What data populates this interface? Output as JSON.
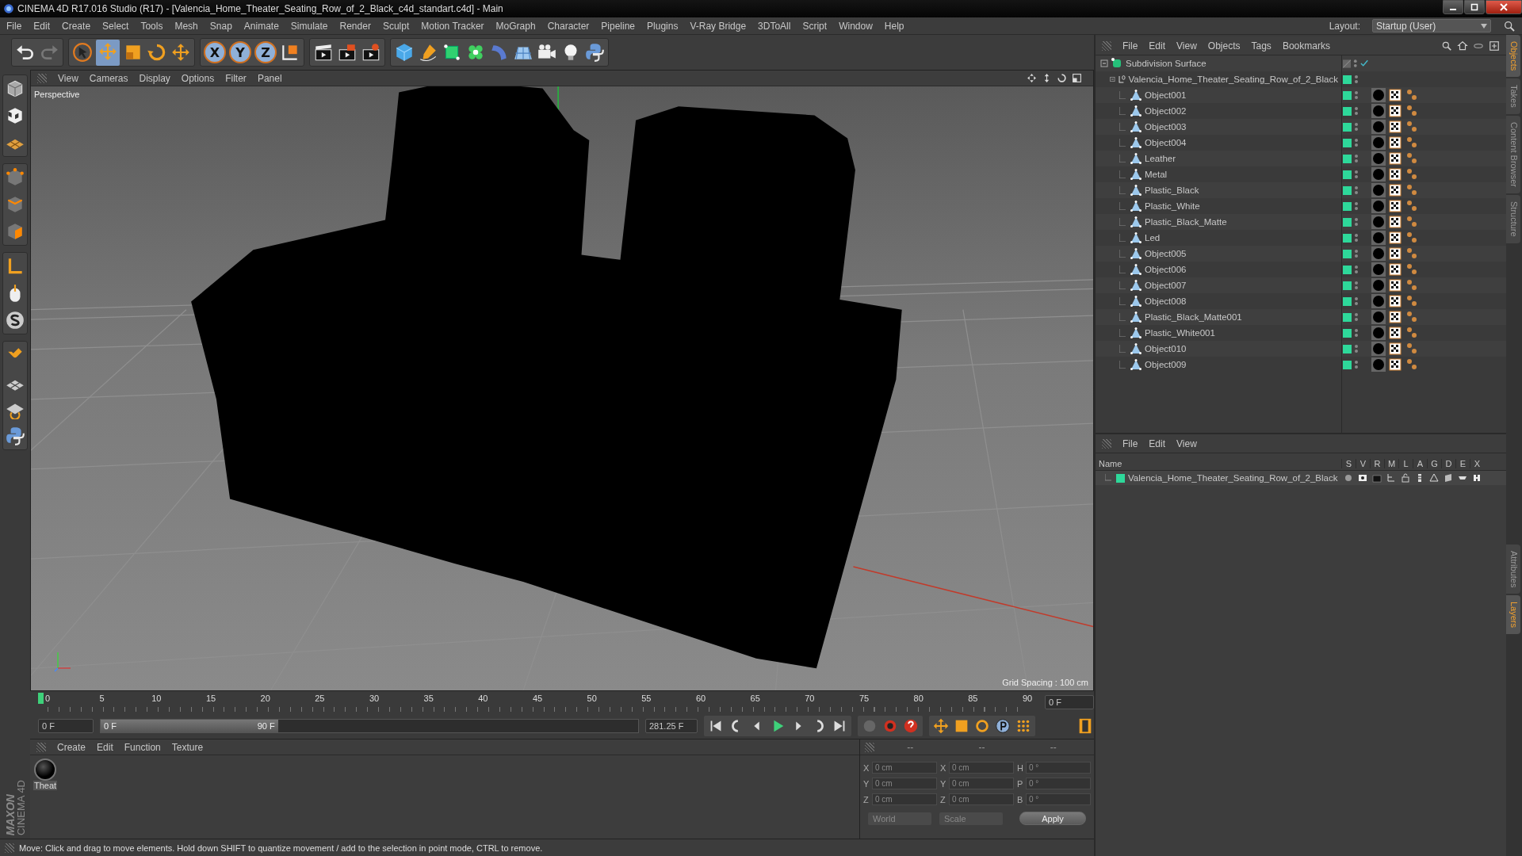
{
  "window": {
    "title": "CINEMA 4D R17.016 Studio (R17) - [Valencia_Home_Theater_Seating_Row_of_2_Black_c4d_standart.c4d] - Main"
  },
  "menu_bar": [
    "File",
    "Edit",
    "Create",
    "Select",
    "Tools",
    "Mesh",
    "Snap",
    "Animate",
    "Simulate",
    "Render",
    "Sculpt",
    "Motion Tracker",
    "MoGraph",
    "Character",
    "Pipeline",
    "Plugins",
    "V-Ray Bridge",
    "3DToAll",
    "Script",
    "Window",
    "Help"
  ],
  "layout": {
    "label": "Layout:",
    "value": "Startup (User)"
  },
  "axis_buttons": [
    {
      "label": "X",
      "selected": true
    },
    {
      "label": "Y",
      "selected": true
    },
    {
      "label": "Z",
      "selected": true
    }
  ],
  "viewport": {
    "menu": [
      "View",
      "Cameras",
      "Display",
      "Options",
      "Filter",
      "Panel"
    ],
    "camera": "Perspective",
    "grid_spacing": "Grid Spacing : 100 cm"
  },
  "object_manager": {
    "menu": [
      "File",
      "Edit",
      "View",
      "Objects",
      "Tags",
      "Bookmarks"
    ],
    "tree": [
      {
        "name": "Subdivision Surface",
        "kind": "generator",
        "expanded": true,
        "children": [
          {
            "name": "Valencia_Home_Theater_Seating_Row_of_2_Black",
            "kind": "null",
            "expanded": true,
            "children": [
              {
                "name": "Object001",
                "kind": "polygon"
              },
              {
                "name": "Object002",
                "kind": "polygon"
              },
              {
                "name": "Object003",
                "kind": "polygon"
              },
              {
                "name": "Object004",
                "kind": "polygon"
              },
              {
                "name": "Leather",
                "kind": "polygon"
              },
              {
                "name": "Metal",
                "kind": "polygon"
              },
              {
                "name": "Plastic_Black",
                "kind": "polygon"
              },
              {
                "name": "Plastic_White",
                "kind": "polygon"
              },
              {
                "name": "Plastic_Black_Matte",
                "kind": "polygon"
              },
              {
                "name": "Led",
                "kind": "polygon"
              },
              {
                "name": "Object005",
                "kind": "polygon"
              },
              {
                "name": "Object006",
                "kind": "polygon"
              },
              {
                "name": "Object007",
                "kind": "polygon"
              },
              {
                "name": "Object008",
                "kind": "polygon"
              },
              {
                "name": "Plastic_Black_Matte001",
                "kind": "polygon"
              },
              {
                "name": "Plastic_White001",
                "kind": "polygon"
              },
              {
                "name": "Object010",
                "kind": "polygon"
              },
              {
                "name": "Object009",
                "kind": "polygon"
              }
            ]
          }
        ]
      }
    ]
  },
  "side_tabs": {
    "top": [
      {
        "label": "Objects",
        "selected": true
      },
      {
        "label": "Takes",
        "selected": false
      },
      {
        "label": "Content Browser",
        "selected": false
      },
      {
        "label": "Structure",
        "selected": false
      }
    ],
    "bottom": [
      {
        "label": "Attributes",
        "selected": false
      },
      {
        "label": "Layers",
        "selected": true
      }
    ]
  },
  "layer_manager": {
    "menu": [
      "File",
      "Edit",
      "View"
    ],
    "columns": [
      "Name",
      "S",
      "V",
      "R",
      "M",
      "L",
      "A",
      "G",
      "D",
      "E",
      "X"
    ],
    "rows": [
      {
        "name": "Valencia_Home_Theater_Seating_Row_of_2_Black",
        "color": "#2ed89a"
      }
    ]
  },
  "timeline": {
    "ticks": [
      "0",
      "5",
      "10",
      "15",
      "20",
      "25",
      "30",
      "35",
      "40",
      "45",
      "50",
      "55",
      "60",
      "65",
      "70",
      "75",
      "80",
      "85",
      "90"
    ],
    "current_frame": "0 F",
    "start_frame": "0 F",
    "range": {
      "start": "0 F",
      "end": "90 F",
      "level": 0.33
    },
    "end_frame": "281.25 F"
  },
  "material_manager": {
    "menu": [
      "Create",
      "Edit",
      "Function",
      "Texture"
    ],
    "materials": [
      {
        "name": "Theat"
      }
    ]
  },
  "coordinates": {
    "headers": [
      "--",
      "--",
      "--"
    ],
    "columns": [
      [
        {
          "axis": "X",
          "value": "0 cm"
        },
        {
          "axis": "Y",
          "value": "0 cm"
        },
        {
          "axis": "Z",
          "value": "0 cm"
        }
      ],
      [
        {
          "axis": "X",
          "value": "0 cm"
        },
        {
          "axis": "Y",
          "value": "0 cm"
        },
        {
          "axis": "Z",
          "value": "0 cm"
        }
      ],
      [
        {
          "axis": "H",
          "value": "0 °"
        },
        {
          "axis": "P",
          "value": "0 °"
        },
        {
          "axis": "B",
          "value": "0 °"
        }
      ]
    ],
    "dropdowns": [
      "World",
      "Scale"
    ],
    "apply": "Apply"
  },
  "brand": {
    "company": "MAXON",
    "product": "CINEMA 4D"
  },
  "status_bar": "Move: Click and drag to move elements. Hold down SHIFT to quantize movement / add to the selection in point mode, CTRL to remove."
}
